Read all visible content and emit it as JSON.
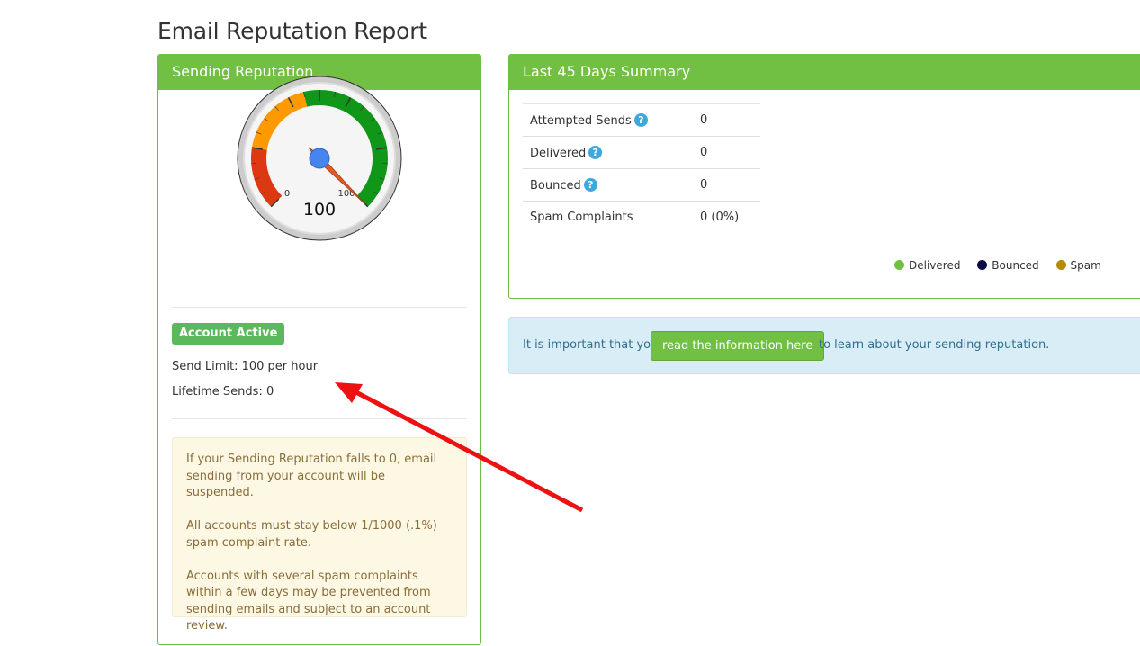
{
  "page_title": "Email Reputation Report",
  "reputation_panel": {
    "heading": "Sending Reputation",
    "gauge": {
      "value": 100,
      "min_label": "0",
      "max_label": "100",
      "value_label": "100",
      "colors": {
        "red": "#dc3912",
        "orange": "#ff9900",
        "green": "#109618",
        "needle": "#e35b2c",
        "hub": "#4684ee"
      }
    },
    "status_badge": "Account Active",
    "send_limit": "Send Limit: 100 per hour",
    "lifetime_sends": "Lifetime Sends: 0",
    "warnings": [
      "If your Sending Reputation falls to 0, email sending from your account will be suspended.",
      "All accounts must stay below 1/1000 (.1%) spam complaint rate.",
      "Accounts with several spam complaints within a few days may be prevented from sending emails and subject to an account review."
    ]
  },
  "summary_panel": {
    "heading": "Last 45 Days Summary",
    "rows": [
      {
        "label": "Attempted Sends",
        "value": "0",
        "help": true
      },
      {
        "label": "Delivered",
        "value": "0",
        "help": true
      },
      {
        "label": "Bounced",
        "value": "0",
        "help": true
      },
      {
        "label": "Spam Complaints",
        "value": "0 (0%)",
        "help": false
      }
    ],
    "help_icon_glyph": "?",
    "legend": [
      {
        "label": "Delivered",
        "color": "#72c043"
      },
      {
        "label": "Bounced",
        "color": "#0b0b45"
      },
      {
        "label": "Spam",
        "color": "#b58b00"
      }
    ]
  },
  "info_alert": {
    "text_before": "It is important that you",
    "button_label": "read the information here",
    "text_after": "to learn about your sending reputation."
  },
  "annotation_arrow_color": "#ee1111"
}
